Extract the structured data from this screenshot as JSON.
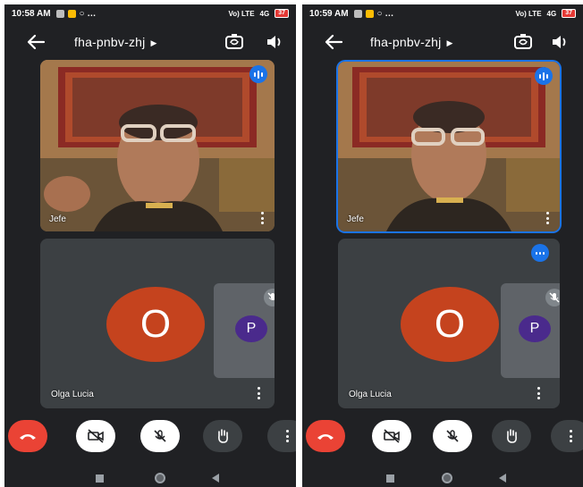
{
  "screens": [
    {
      "status": {
        "time": "10:58 AM",
        "icons": "○ …",
        "network": "Vo) LTE",
        "signal": "4G",
        "battery": "37"
      },
      "header": {
        "meeting_code": "fha-pnbv-zhj",
        "chevron": "▶"
      },
      "tiles": {
        "main": {
          "name": "Jefe"
        },
        "second": {
          "name": "Olga Lucia",
          "avatar_letter": "O"
        },
        "self": {
          "avatar_letter": "P"
        }
      }
    },
    {
      "status": {
        "time": "10:59 AM",
        "icons": "○ …",
        "network": "Vo) LTE",
        "signal": "4G",
        "battery": "37"
      },
      "header": {
        "meeting_code": "fha-pnbv-zhj",
        "chevron": "▶"
      },
      "tiles": {
        "main": {
          "name": "Jefe"
        },
        "second": {
          "name": "Olga Lucia",
          "avatar_letter": "O"
        },
        "self": {
          "avatar_letter": "P"
        }
      }
    }
  ],
  "colors": {
    "background": "#202124",
    "tile": "#3c4043",
    "end_call": "#ea4335",
    "avatar_o": "#c5431e",
    "avatar_p": "#4a2a8c",
    "active_speaker": "#1a73e8"
  },
  "icons": {
    "back": "arrow-left-icon",
    "camera_switch": "camera-switch-icon",
    "speaker": "speaker-icon",
    "end_call": "phone-hangup-icon",
    "camera": "camera-off-icon",
    "mic": "mic-off-icon",
    "hand": "raise-hand-icon",
    "more": "more-vert-icon"
  }
}
